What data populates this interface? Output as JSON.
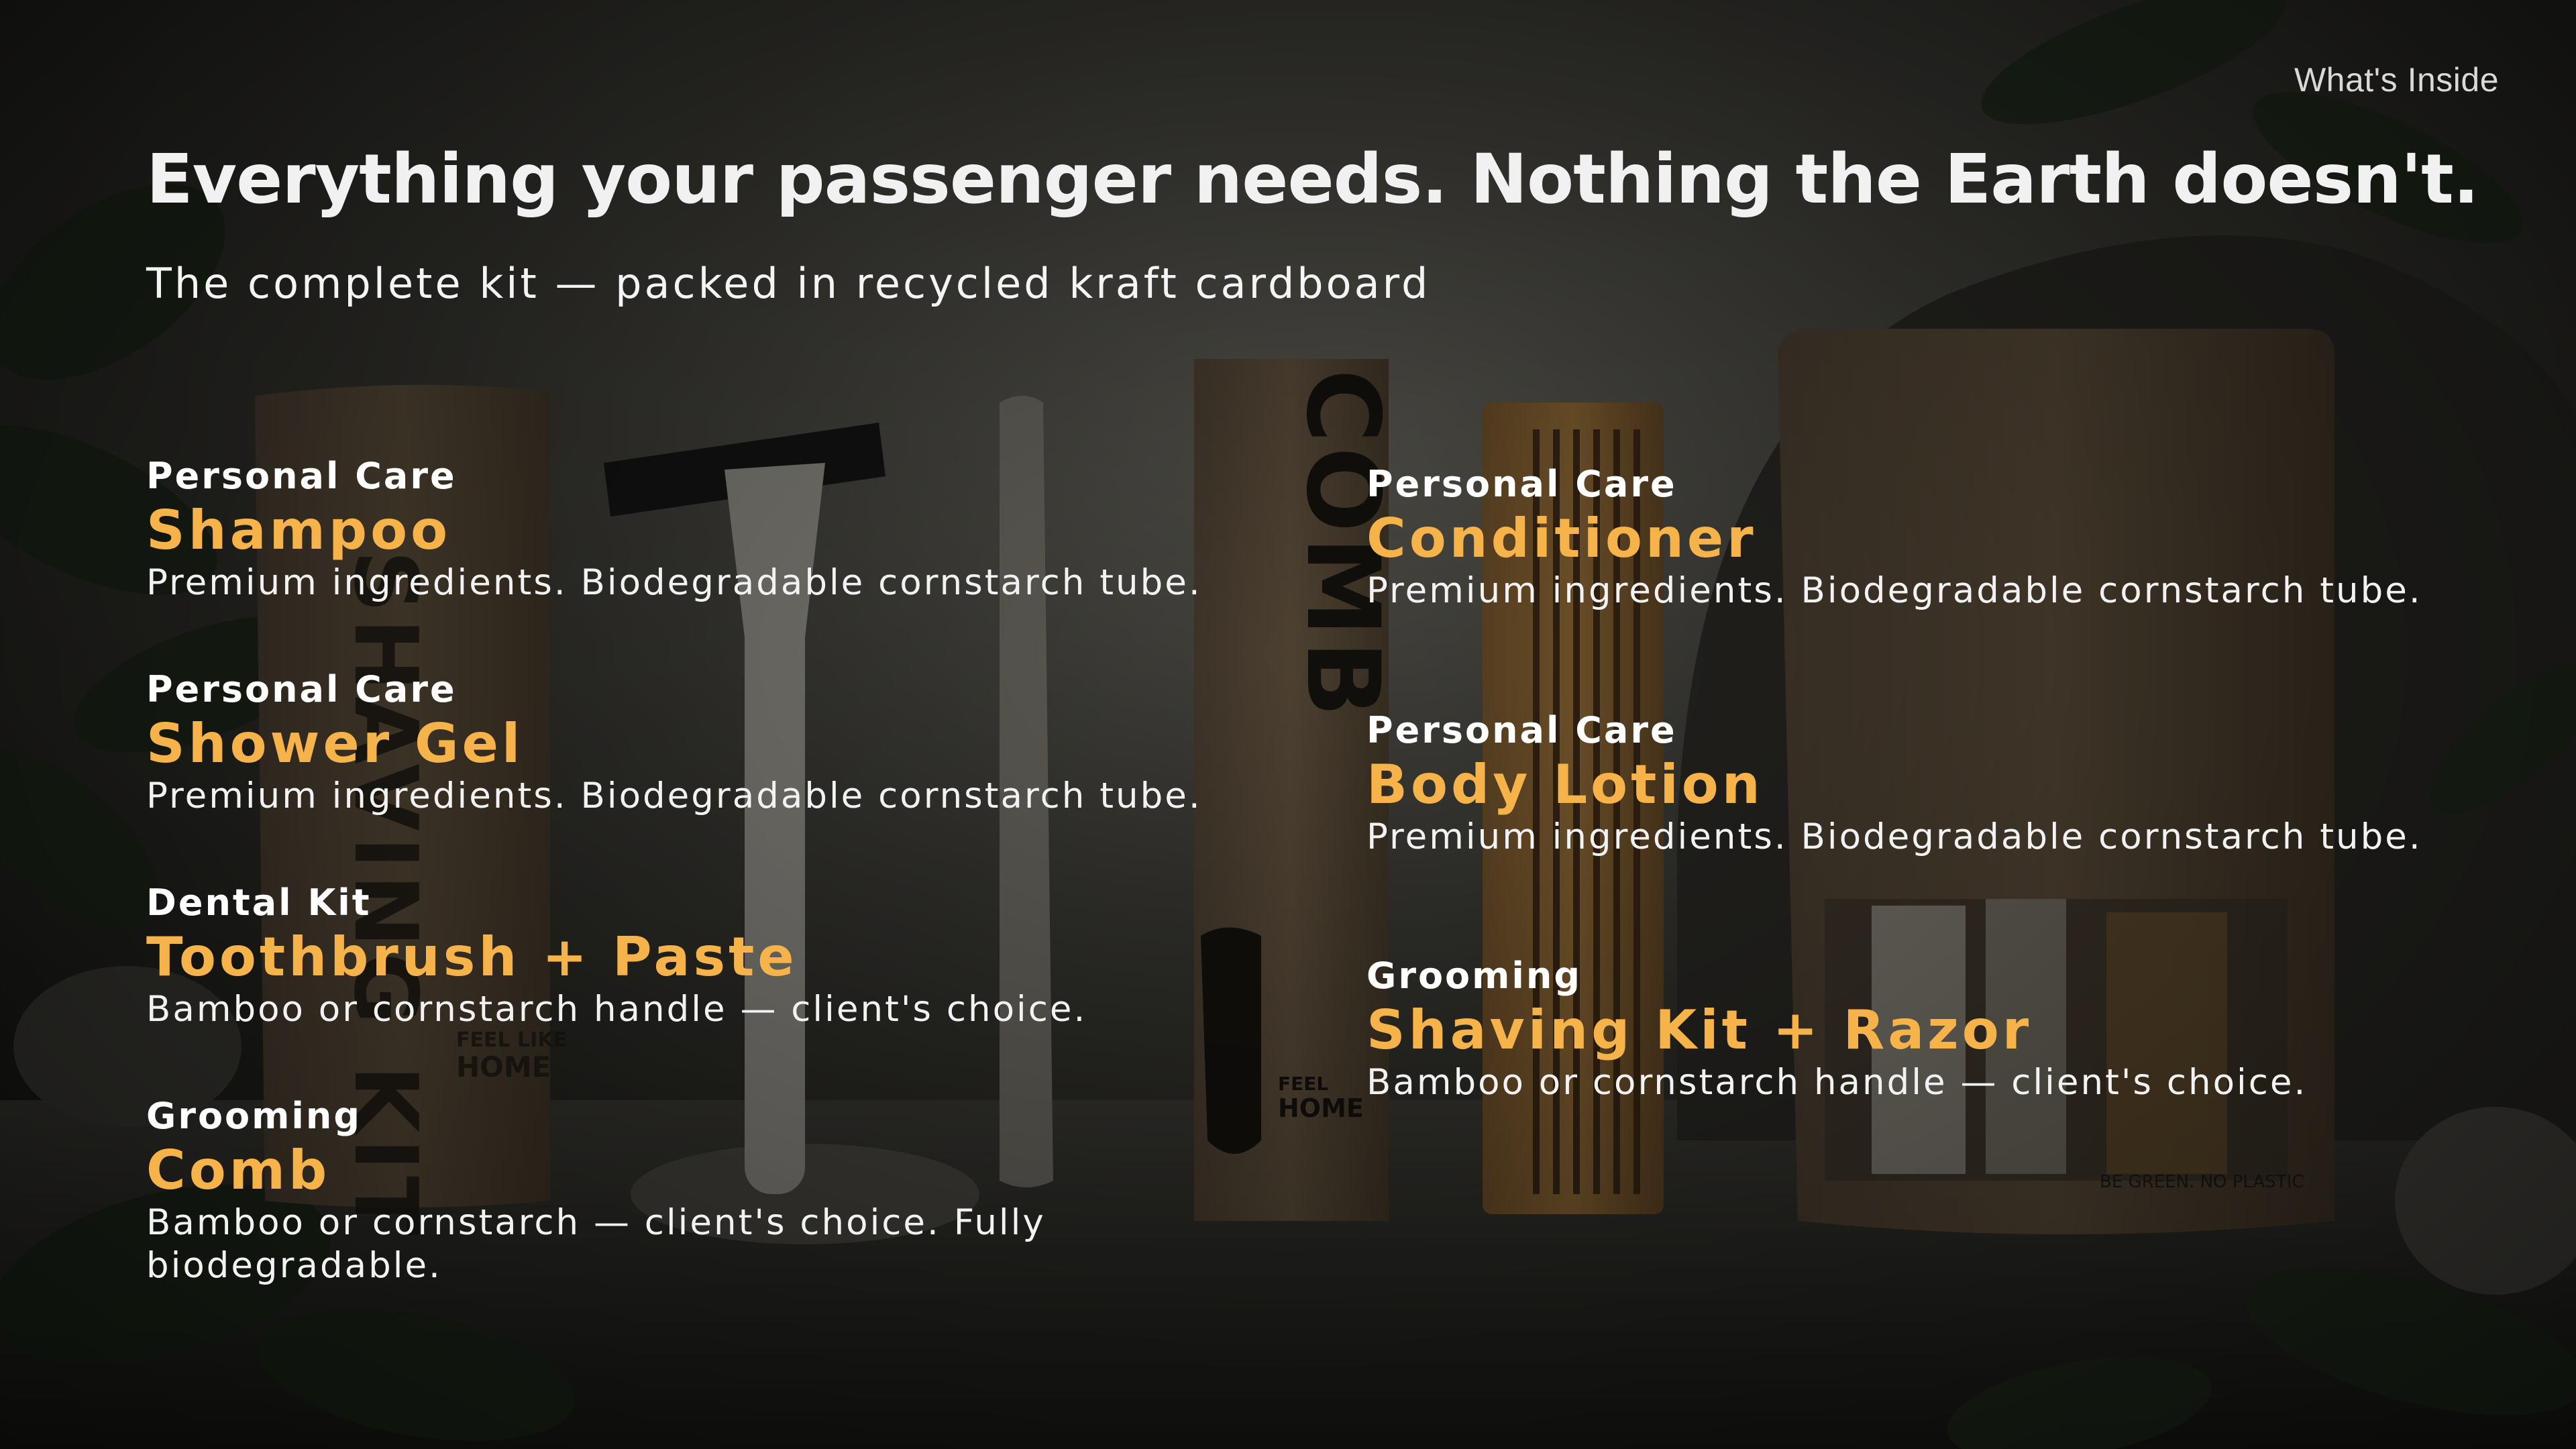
{
  "header": {
    "section_tag": "What's Inside",
    "title": "Everything your passenger needs. Nothing the Earth doesn't.",
    "subtitle": "The complete kit — packed in recycled kraft cardboard"
  },
  "items_left": [
    {
      "category": "Personal Care",
      "name": "Shampoo",
      "description": "Premium ingredients. Biodegradable cornstarch tube."
    },
    {
      "category": "Personal Care",
      "name": "Shower Gel",
      "description": "Premium ingredients. Biodegradable cornstarch tube."
    },
    {
      "category": "Dental Kit",
      "name": "Toothbrush + Paste",
      "description": "Bamboo or cornstarch handle — client's choice."
    },
    {
      "category": "Grooming",
      "name": "Comb",
      "description": "Bamboo or cornstarch — client's choice. Fully biodegradable."
    }
  ],
  "items_right": [
    {
      "category": "Personal Care",
      "name": "Conditioner",
      "description": "Premium ingredients. Biodegradable cornstarch tube."
    },
    {
      "category": "Personal Care",
      "name": "Body Lotion",
      "description": "Premium ingredients. Biodegradable cornstarch tube."
    },
    {
      "category": "Grooming",
      "name": "Shaving Kit + Razor",
      "description": "Bamboo or cornstarch handle — client's choice."
    }
  ],
  "background_labels": {
    "comb_box": "COMB",
    "shaving_kit_pouch": "SHAVING KIT",
    "brand_left": "FEEL LIKE HOME",
    "brand_right": "FEEL LIKE HOME",
    "pouch_slogan": "BE GREEN. NO PLASTIC"
  },
  "colors": {
    "accent": "#f6b34a",
    "text": "#ffffff",
    "background": "#1c1c19"
  }
}
